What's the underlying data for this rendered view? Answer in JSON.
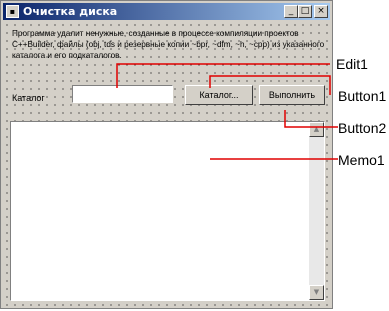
{
  "window": {
    "title": "Очистка диска",
    "minimize_glyph": "_",
    "maximize_glyph": "□",
    "close_glyph": "×"
  },
  "form": {
    "description": "Программа удалит ненужные, созданные в процессе компиляции проектов C++Builder, файлы (obj, tds и резервные копии ~bpr, ~dfm, ~h, ~cpp) из указанного каталога и его подкаталогов.",
    "catalog_label": "Каталог",
    "catalog_value": "",
    "catalog_button": "Каталог...",
    "run_button": "Выполнить",
    "memo_text": ""
  },
  "annotations": {
    "edit1": "Edit1",
    "button1": "Button1",
    "button2": "Button2",
    "memo1": "Memo1"
  },
  "colors": {
    "annotation_line": "#e00000",
    "titlebar_start": "#0a246a",
    "titlebar_end": "#a6caf0"
  }
}
